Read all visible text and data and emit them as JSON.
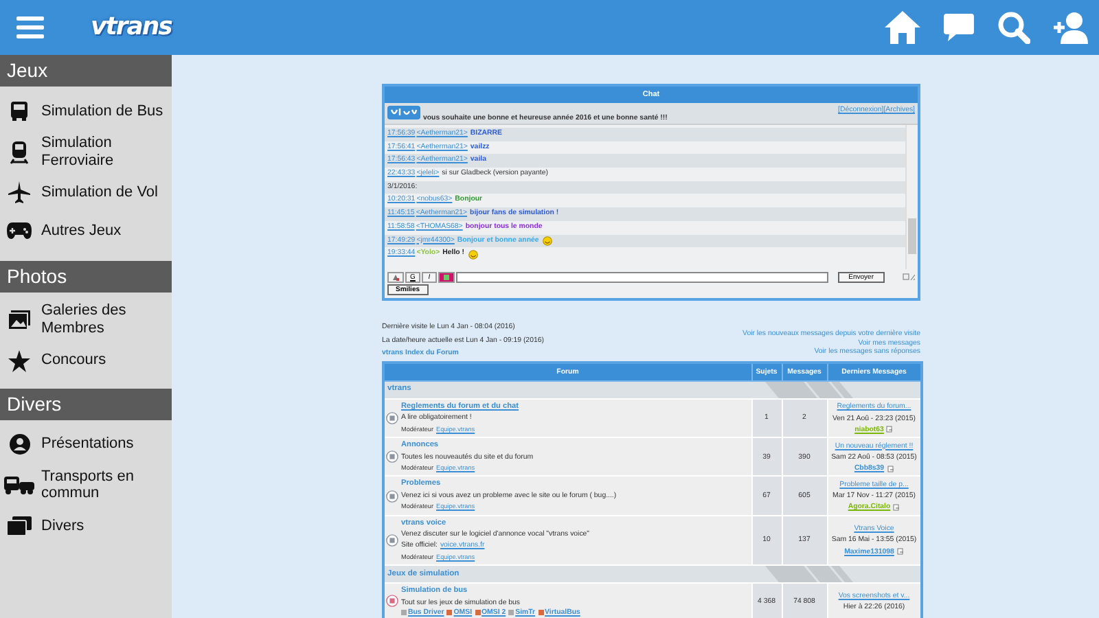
{
  "topbar": {
    "logo": "vtrans"
  },
  "sidebar": [
    {
      "title": "Jeux",
      "items": [
        "Simulation de Bus",
        "Simulation Ferroviaire",
        "Simulation de Vol",
        "Autres Jeux"
      ]
    },
    {
      "title": "Photos",
      "items": [
        "Galeries des Membres",
        "Concours"
      ]
    },
    {
      "title": "Divers",
      "items": [
        "Présentations",
        "Transports en commun",
        "Divers"
      ]
    }
  ],
  "chat": {
    "title": "Chat",
    "banner": "vous souhaite une bonne et heureuse année 2016 et une bonne santé !!!",
    "links": [
      "[Déconnexion]",
      "[Archives]"
    ],
    "messages": [
      {
        "kind": "message",
        "time": "17:56:39",
        "user": "<Aetherman21>",
        "text": "BIZARRE",
        "color": "#2a5bd7",
        "bold": true,
        "smiley": false
      },
      {
        "kind": "message",
        "time": "17:56:41",
        "user": "<Aetherman21>",
        "text": "vailzz",
        "color": "#2a5bd7",
        "bold": true,
        "smiley": false
      },
      {
        "kind": "message",
        "time": "17:56:43",
        "user": "<Aetherman21>",
        "text": "vaila",
        "color": "#2a5bd7",
        "bold": true,
        "smiley": false
      },
      {
        "kind": "message",
        "time": "22:43:33",
        "user": "<jeleli>",
        "text": "si sur Gladbeck (version payante)",
        "bold": false,
        "smiley": false
      },
      {
        "kind": "date",
        "text": "3/1/2016:"
      },
      {
        "kind": "message",
        "time": "10:20:31",
        "user": "<nobus63>",
        "text": "Bonjour",
        "color": "#2e9a2e",
        "bold": true,
        "smiley": false
      },
      {
        "kind": "message",
        "time": "11:45:15",
        "user": "<Aetherman21>",
        "text": "bijour fans de simulation !",
        "color": "#2a5bd7",
        "bold": true,
        "smiley": false
      },
      {
        "kind": "message",
        "time": "11:58:58",
        "user": "<THOMAS68>",
        "text": "bonjour tous le monde",
        "color": "#8a2be2",
        "bold": true,
        "smiley": false
      },
      {
        "kind": "message",
        "time": "17:49:29",
        "user": "<jmr44300>",
        "text": "Bonjour et bonne année",
        "color": "#33aaee",
        "bold": true,
        "smiley": true
      },
      {
        "kind": "message",
        "time": "19:33:44",
        "user": {
          "name": "<Yolo>",
          "color": "#8cc43c"
        },
        "text": "Hello !",
        "color": "#222222",
        "bold": true,
        "smiley": true
      }
    ],
    "format_buttons": [
      "G",
      "I"
    ],
    "send_button": "Envoyer",
    "smilies_button": "Smilies"
  },
  "info": {
    "last_visit": "Dernière visite le Lun 4 Jan - 08:04 (2016)",
    "current": "La date/heure actuelle est Lun 4 Jan - 09:19 (2016)",
    "index_link": "vtrans Index du Forum",
    "links": [
      "Voir les nouveaux messages depuis votre dernière visite",
      "Voir mes messages",
      "Voir les messages sans réponses"
    ]
  },
  "forum": {
    "columns": [
      "Forum",
      "Sujets",
      "Messages",
      "Derniers Messages"
    ],
    "rows": [
      {
        "kind": "category",
        "title": "vtrans"
      },
      {
        "kind": "forum",
        "unread": false,
        "title": "Reglements du forum et du chat",
        "description": "A lire obligatoirement !",
        "moderator_label": "Modérateur",
        "moderator": "Equipe.vtrans",
        "topics": "1",
        "posts": "2",
        "last_title": "Reglements du forum...",
        "last_date": "Ven 21 Aoû - 23:23 (2015)",
        "last_author": {
          "name": "niabot63",
          "color": "#7ab800"
        }
      },
      {
        "kind": "forum",
        "unread": false,
        "title": "Annonces",
        "description": "Toutes les nouveautés du site et du forum",
        "moderator_label": "Modérateur",
        "moderator": "Equipe.vtrans",
        "topics": "39",
        "posts": "390",
        "last_title": "Un nouveau réglement !!",
        "last_date": "Sam 22 Aoû - 08:53 (2015)",
        "last_author": {
          "name": "Cbb8s39",
          "color": "#3a8fd6"
        }
      },
      {
        "kind": "forum",
        "unread": false,
        "title": "Problemes",
        "description": "Venez ici si vous avez un probleme avec le site ou le forum ( bug....)",
        "moderator_label": "Modérateur",
        "moderator": "Equipe.vtrans",
        "topics": "67",
        "posts": "605",
        "last_title": "Probleme taille de p...",
        "last_date": "Mar 17 Nov - 11:27 (2015)",
        "last_author": {
          "name": "Agora.Citalo",
          "color": "#7ab800"
        }
      },
      {
        "kind": "forum",
        "unread": false,
        "title": "vtrans voice",
        "description": "Venez discuter sur le logiciel d'annonce vocal \"vtrans voice\"",
        "extra_label": "Site officiel:",
        "extra_link": "voice.vtrans.fr",
        "moderator_label": "Modérateur",
        "moderator": "Equipe.vtrans",
        "topics": "10",
        "posts": "137",
        "last_title": "Vtrans Voice",
        "last_date": "Sam 16 Mai - 13:55 (2015)",
        "last_author": {
          "name": "Maxime131098",
          "color": "#3a8fd6"
        }
      },
      {
        "kind": "category",
        "title": "Jeux de simulation"
      },
      {
        "kind": "forum",
        "unread": true,
        "title": "Simulation de bus",
        "description": "Tout sur les jeux de simulation de bus",
        "subforums": [
          "Bus Driver",
          "OMSI",
          "OMSI 2",
          "SimTr",
          "VirtualBus"
        ],
        "topics": "4 368",
        "posts": "74 808",
        "last_title": "Vos screenshots et v...",
        "last_date": "Hier à 22:26 (2016)"
      }
    ]
  }
}
